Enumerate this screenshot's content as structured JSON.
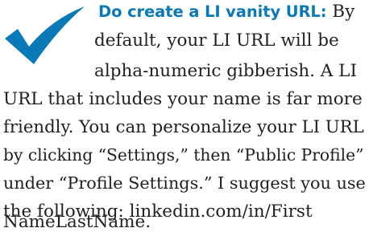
{
  "tip": {
    "heading": "Do create a LI vanity URL:",
    "lines": [
      "By",
      "default, your LI URL will be",
      "alpha-numeric gibberish. A LI",
      "URL that includes your name is far more",
      "friendly. You can personalize your LI URL",
      "by clicking “Settings,” then “Public Profile”",
      "under “Profile Settings.” I suggest you use",
      "the following: linkedin.com/in/First",
      "NameLastName."
    ]
  },
  "colors": {
    "heading": "#0a79b8",
    "checkmark": "#0a79b8",
    "body_text": "#231f20"
  },
  "icon": "checkmark-icon"
}
